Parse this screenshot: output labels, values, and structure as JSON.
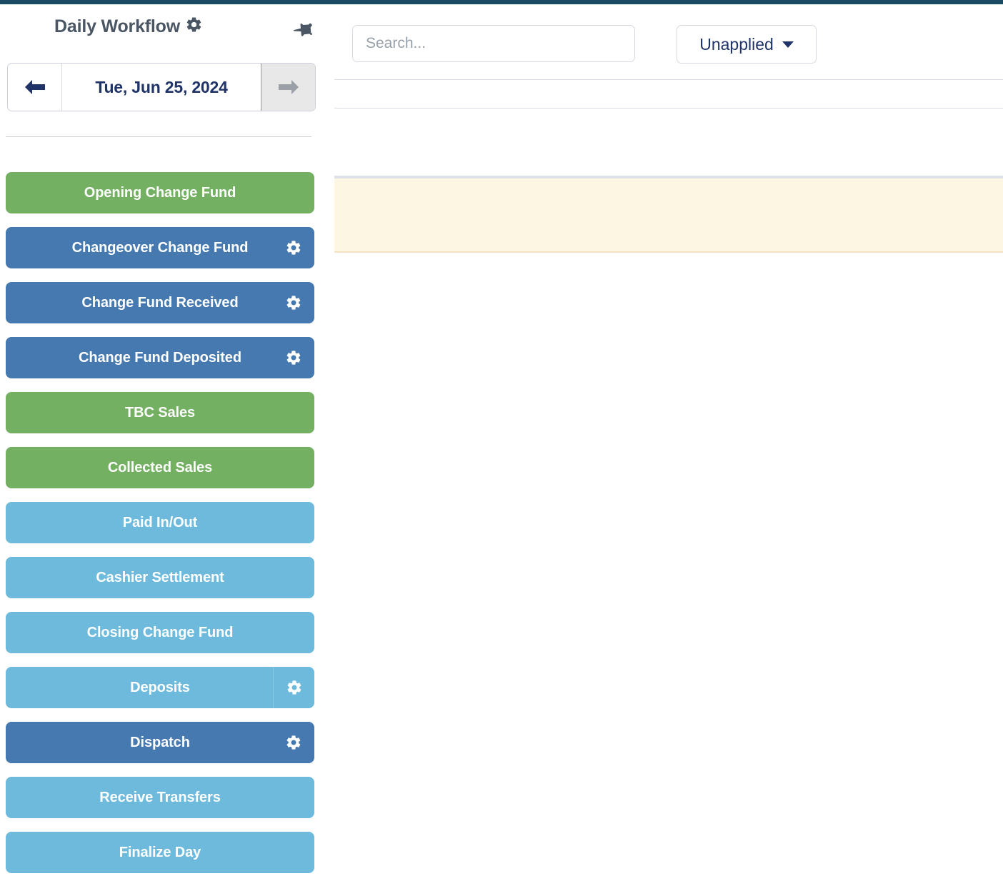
{
  "theme": {
    "accent_bar": "#1b4a63",
    "green": "#74b062",
    "blue": "#4579b0",
    "light_blue": "#6ebadd",
    "cream": "#fdf6e3",
    "navy_text": "#1f3368"
  },
  "sidebar": {
    "title": "Daily Workflow",
    "title_gear_icon": "gear-icon",
    "pin_icon": "pin-icon",
    "date_nav": {
      "prev_icon": "arrow-left-icon",
      "current_date": "Tue, Jun 25, 2024",
      "next_icon": "arrow-right-icon"
    },
    "workflow_items": [
      {
        "label": "Opening Change Fund",
        "color": "green",
        "gear": false,
        "gear_sep": false
      },
      {
        "label": "Changeover Change Fund",
        "color": "blue",
        "gear": true,
        "gear_sep": false
      },
      {
        "label": "Change Fund Received",
        "color": "blue",
        "gear": true,
        "gear_sep": false
      },
      {
        "label": "Change Fund Deposited",
        "color": "blue",
        "gear": true,
        "gear_sep": false
      },
      {
        "label": "TBC Sales",
        "color": "green",
        "gear": false,
        "gear_sep": false
      },
      {
        "label": "Collected Sales",
        "color": "green",
        "gear": false,
        "gear_sep": false
      },
      {
        "label": "Paid In/Out",
        "color": "lightblue",
        "gear": false,
        "gear_sep": false
      },
      {
        "label": "Cashier Settlement",
        "color": "lightblue",
        "gear": false,
        "gear_sep": false
      },
      {
        "label": "Closing Change Fund",
        "color": "lightblue",
        "gear": false,
        "gear_sep": false
      },
      {
        "label": "Deposits",
        "color": "lightblue",
        "gear": true,
        "gear_sep": true
      },
      {
        "label": "Dispatch",
        "color": "blue",
        "gear": true,
        "gear_sep": false
      },
      {
        "label": "Receive Transfers",
        "color": "lightblue",
        "gear": false,
        "gear_sep": false
      },
      {
        "label": "Finalize Day",
        "color": "lightblue",
        "gear": false,
        "gear_sep": false
      }
    ]
  },
  "main": {
    "search": {
      "value": "",
      "placeholder": "Search..."
    },
    "filter": {
      "selected": "Unapplied",
      "caret_icon": "chevron-down-icon"
    }
  }
}
